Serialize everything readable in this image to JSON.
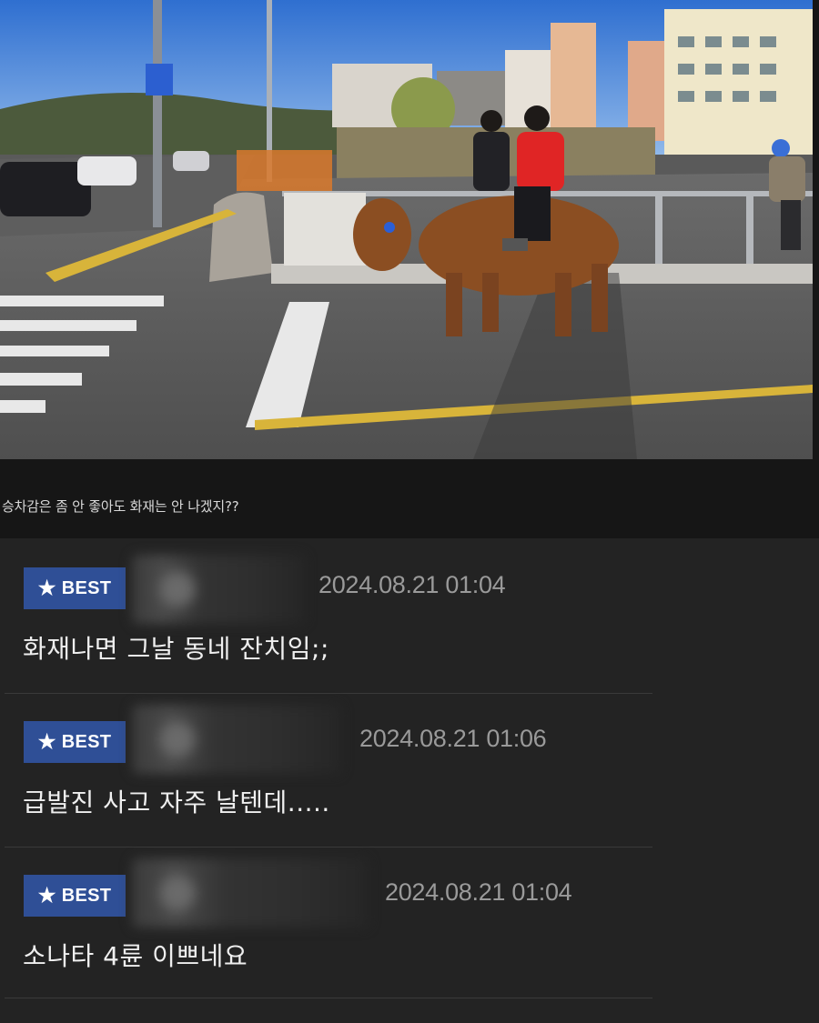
{
  "post": {
    "caption": "승차감은 좀 안 좋아도 화재는 안 나겠지??",
    "photo_alt": "cow-photo"
  },
  "comments": [
    {
      "badge": "BEST",
      "date": "2024.08.21 01:04",
      "text": "화재나면 그날 동네 잔치임;;"
    },
    {
      "badge": "BEST",
      "date": "2024.08.21 01:06",
      "text": "급발진 사고 자주 날텐데....."
    },
    {
      "badge": "BEST",
      "date": "2024.08.21 01:04",
      "text": "소나타 4륜 이쁘네요"
    }
  ],
  "colors": {
    "background": "#161616",
    "comment_panel": "#232323",
    "badge": "#2f4f96",
    "date": "#9a9a9a"
  }
}
